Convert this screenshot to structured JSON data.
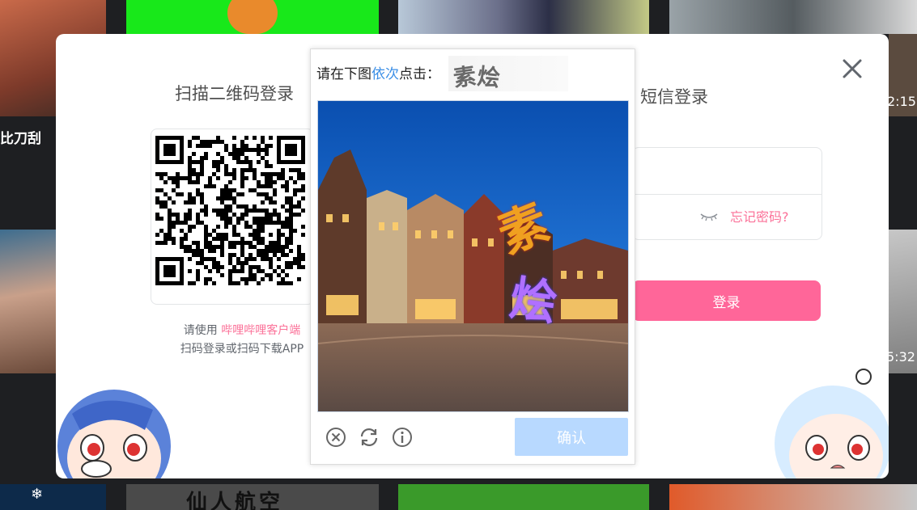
{
  "background": {
    "caption_left": "比刀刮",
    "time_top_right": "2:15",
    "time_mid_right": "5:32",
    "thumb_bottom_text": "仙人航空"
  },
  "modal": {
    "close_icon": "close-icon",
    "qr": {
      "title": "扫描二维码登录",
      "hint_prefix": "请使用 ",
      "hint_link": "哔哩哔哩客户端",
      "hint_line2": "扫码登录或扫码下载APP"
    },
    "sms": {
      "title": "短信登录",
      "forgot": "忘记密码?",
      "login_button": "登录"
    }
  },
  "captcha": {
    "prompt_prefix": "请在下图",
    "prompt_highlight": "依次",
    "prompt_suffix": "点击：",
    "target_chars": [
      "素",
      "烩"
    ],
    "confirm_button": "确认",
    "icons": [
      "close-circle-icon",
      "refresh-icon",
      "info-icon"
    ]
  },
  "colors": {
    "accent_pink": "#fb7299",
    "login_button": "#ff6699",
    "confirm_button": "#b8d9ff",
    "prompt_blue": "#3a8ee6"
  }
}
